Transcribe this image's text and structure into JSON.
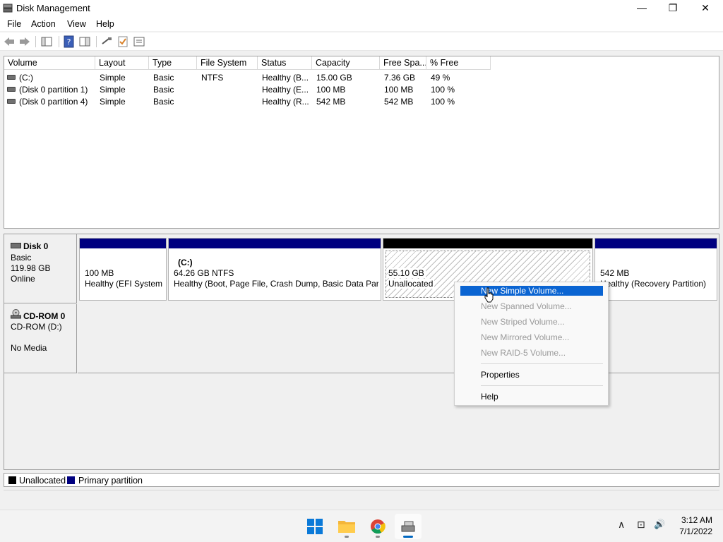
{
  "window": {
    "title": "Disk Management",
    "controls": {
      "minimize": "—",
      "maximize": "❐",
      "close": "✕"
    }
  },
  "menu": [
    "File",
    "Action",
    "View",
    "Help"
  ],
  "volume_list": {
    "columns": [
      "Volume",
      "Layout",
      "Type",
      "File System",
      "Status",
      "Capacity",
      "Free Spa...",
      "% Free"
    ],
    "rows": [
      [
        "(C:)",
        "Simple",
        "Basic",
        "NTFS",
        "Healthy (B...",
        "15.00 GB",
        "7.36 GB",
        "49 %"
      ],
      [
        "(Disk 0 partition 1)",
        "Simple",
        "Basic",
        "",
        "Healthy (E...",
        "100 MB",
        "100 MB",
        "100 %"
      ],
      [
        "(Disk 0 partition 4)",
        "Simple",
        "Basic",
        "",
        "Healthy (R...",
        "542 MB",
        "542 MB",
        "100 %"
      ]
    ]
  },
  "disks": {
    "disk0": {
      "name": "Disk 0",
      "type": "Basic",
      "size": "119.98 GB",
      "status": "Online",
      "partitions": [
        {
          "title": "",
          "size": "100 MB",
          "desc": "Healthy (EFI System P"
        },
        {
          "title": "(C:)",
          "size": "64.26 GB NTFS",
          "desc": "Healthy (Boot, Page File, Crash Dump, Basic Data Partit"
        },
        {
          "title": "",
          "size": "55.10 GB",
          "desc": "Unallocated"
        },
        {
          "title": "",
          "size": "542 MB",
          "desc": "Healthy (Recovery Partition)"
        }
      ]
    },
    "cdrom0": {
      "name": "CD-ROM 0",
      "drive": "CD-ROM (D:)",
      "media": "No Media"
    }
  },
  "legend": {
    "unallocated": "Unallocated",
    "primary": "Primary partition",
    "colors": {
      "unallocated": "#000000",
      "primary": "#000080"
    }
  },
  "context_menu": {
    "items": [
      {
        "label": "New Simple Volume...",
        "state": "highlighted"
      },
      {
        "label": "New Spanned Volume...",
        "state": "disabled"
      },
      {
        "label": "New Striped Volume...",
        "state": "disabled"
      },
      {
        "label": "New Mirrored Volume...",
        "state": "disabled"
      },
      {
        "label": "New RAID-5 Volume...",
        "state": "disabled"
      },
      {
        "label": "Properties",
        "state": "enabled"
      },
      {
        "label": "Help",
        "state": "enabled"
      }
    ]
  },
  "taskbar": {
    "apps": [
      "start-icon",
      "file-explorer-icon",
      "chrome-icon",
      "disk-management-icon"
    ],
    "tray": {
      "chevron": "∧",
      "network": "⊡",
      "volume": "🔊"
    },
    "clock": {
      "time": "3:12 AM",
      "date": "7/1/2022"
    }
  },
  "colors": {
    "highlight": "#0a64d2",
    "partition_bar": "#000080",
    "taskbar_active": "#0067c0"
  }
}
